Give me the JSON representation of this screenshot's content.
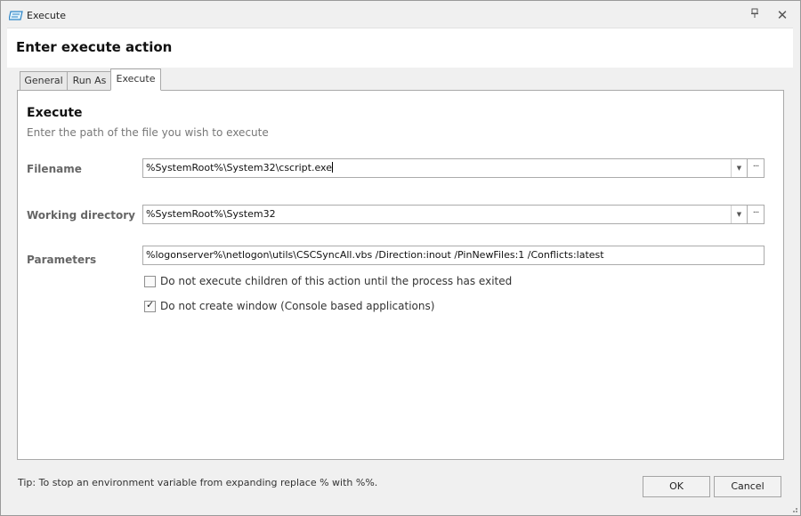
{
  "window": {
    "title": "Execute"
  },
  "titlebar": {
    "pin_icon": "pin-icon",
    "close_glyph": "✕"
  },
  "dialog": {
    "heading": "Enter execute action"
  },
  "tabs": [
    {
      "label": "General",
      "active": false
    },
    {
      "label": "Run As",
      "active": false
    },
    {
      "label": "Execute",
      "active": true
    }
  ],
  "panel": {
    "title": "Execute",
    "description": "Enter the path of the file you wish to execute",
    "fields": {
      "filename": {
        "label": "Filename",
        "value": "%SystemRoot%\\System32\\cscript.exe"
      },
      "working_directory": {
        "label": "Working directory",
        "value": "%SystemRoot%\\System32"
      },
      "parameters": {
        "label": "Parameters",
        "value": "%logonserver%\\netlogon\\utils\\CSCSyncAll.vbs /Direction:inout /PinNewFiles:1 /Conflicts:latest"
      }
    },
    "options": {
      "wait_children": {
        "label": "Do not execute children of this action until the process has exited",
        "checked": false
      },
      "no_window": {
        "label": "Do not create window (Console based applications)",
        "checked": true
      }
    },
    "browse_label": "···",
    "dropdown_glyph": "▼"
  },
  "footer": {
    "tip": "Tip: To stop an environment variable from expanding replace % with %%.",
    "ok_label": "OK",
    "cancel_label": "Cancel"
  },
  "colors": {
    "window_bg": "#f0f0f0",
    "panel_bg": "#ffffff",
    "border": "#a9a9a9",
    "label_gray": "#666666"
  }
}
